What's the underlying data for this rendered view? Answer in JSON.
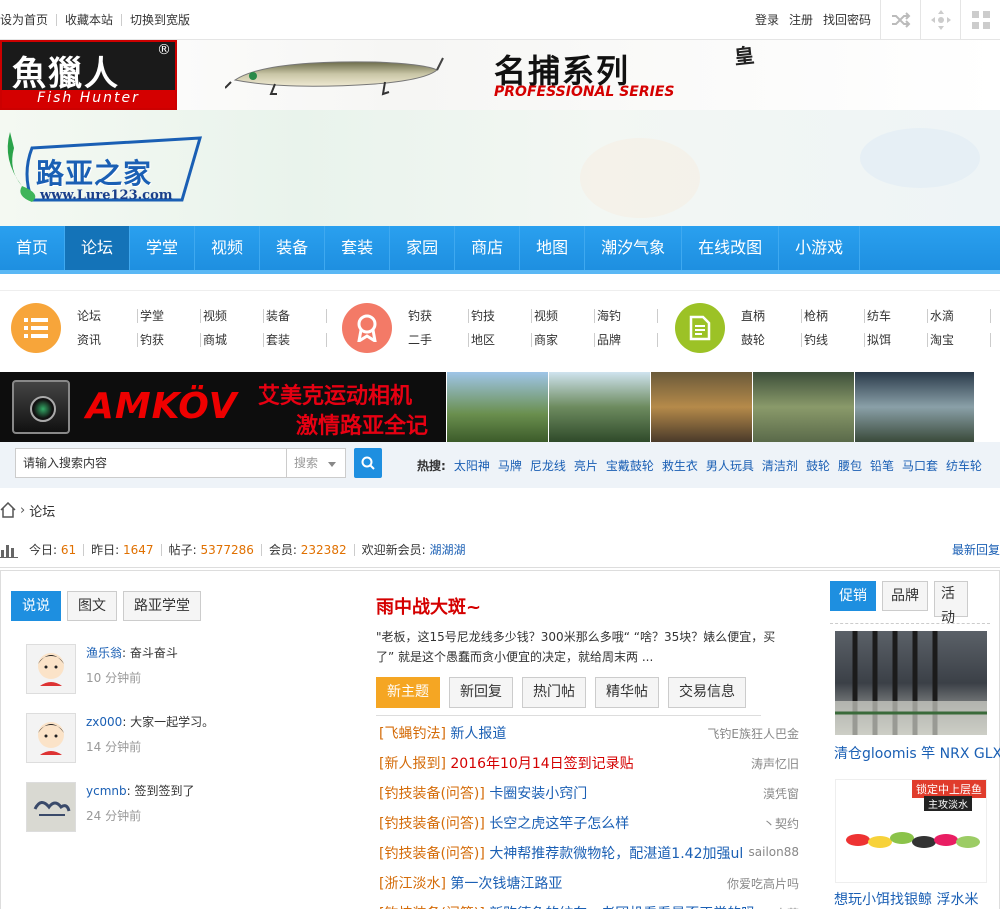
{
  "topbar": {
    "left_links": [
      "设为首页",
      "收藏本站",
      "切换到宽版"
    ],
    "right_links": [
      "登录",
      "注册",
      "找回密码"
    ],
    "icons": [
      "shuffle-icon",
      "move-icon",
      "grid-icon"
    ]
  },
  "banner": {
    "brand_cn": "魚獵人",
    "brand_en": "Fish Hunter",
    "brand_reg": "®",
    "slogan": "名捕系列",
    "slogan_en": "PROFESSIONAL SERIES",
    "slogan_extra": "皇"
  },
  "site": {
    "logo_text": "路亚之家",
    "logo_url": "www.Lure123.com"
  },
  "nav": {
    "items": [
      "首页",
      "论坛",
      "学堂",
      "视频",
      "装备",
      "套装",
      "家园",
      "商店",
      "地图",
      "潮汐气象",
      "在线改图",
      "小游戏"
    ],
    "active_index": 1
  },
  "categories": {
    "group1": {
      "icon": "list-icon",
      "color": "#f7a53a",
      "links": [
        "论坛",
        "学堂",
        "视频",
        "装备",
        "资讯",
        "钓获",
        "商城",
        "套装"
      ]
    },
    "group2": {
      "icon": "award-icon",
      "color": "#f37a67",
      "links": [
        "钓获",
        "钓技",
        "视频",
        "海钓",
        "二手",
        "地区",
        "商家",
        "品牌"
      ]
    },
    "group3": {
      "icon": "document-icon",
      "color": "#9cc226",
      "links": [
        "直柄",
        "枪柄",
        "纺车",
        "水滴",
        "鼓轮",
        "钓线",
        "拟饵",
        "淘宝"
      ]
    }
  },
  "ad": {
    "brand": "AMKÖV",
    "line1": "艾美克运动相机",
    "line2": "激情路亚全记录"
  },
  "search": {
    "placeholder": "请输入搜索内容",
    "select_value": "搜索",
    "hot_label": "热搜:",
    "hot_keywords": [
      "太阳神",
      "马牌",
      "尼龙线",
      "亮片",
      "宝戴鼓轮",
      "救生衣",
      "男人玩具",
      "清洁剂",
      "鼓轮",
      "腰包",
      "铅笔",
      "马口套",
      "纺车轮"
    ]
  },
  "breadcrumb": {
    "current": "论坛"
  },
  "stats": {
    "today_label": "今日:",
    "today": "61",
    "yesterday_label": "昨日:",
    "yesterday": "1647",
    "posts_label": "帖子:",
    "posts": "5377286",
    "members_label": "会员:",
    "members": "232382",
    "welcome_label": "欢迎新会员:",
    "newest": "湖湖湖",
    "latest_link": "最新回复"
  },
  "left_tabs": [
    "说说",
    "图文",
    "路亚学堂"
  ],
  "shouts": [
    {
      "user": "渔乐翁",
      "msg": "奋斗奋斗",
      "time": "10 分钟前"
    },
    {
      "user": "zx000",
      "msg": "大家一起学习。",
      "time": "14 分钟前"
    },
    {
      "user": "ycmnb",
      "msg": "签到签到了",
      "time": "24 分钟前"
    }
  ],
  "feature": {
    "title": "雨中战大斑~",
    "desc": "\"老板，这15号尼龙线多少钱？300米那么多哦“ “啥？35块？婊么便宜，买了” 就是这个愚蠢而贪小便宜的决定，就给周末两 ..."
  },
  "mid_tabs": [
    "新主题",
    "新回复",
    "热门帖",
    "精华帖",
    "交易信息"
  ],
  "threads": [
    {
      "tag": "[飞蝇钓法]",
      "title": "新人报道",
      "author": "飞钓E族狂人巴金",
      "red": false
    },
    {
      "tag": "[新人报到]",
      "title": "2016年10月14日签到记录贴",
      "author": "涛声忆旧",
      "red": true
    },
    {
      "tag": "[钓技装备(问答)]",
      "title": "卡圈安装小窍门",
      "author": "漠凭窗",
      "red": false
    },
    {
      "tag": "[钓技装备(问答)]",
      "title": "长空之虎这竿子怎么样",
      "author": "丶契约",
      "red": false
    },
    {
      "tag": "[钓技装备(问答)]",
      "title": "大神帮推荐款微物轮，配湛道1.42加强ul",
      "author": "sailon88",
      "red": false
    },
    {
      "tag": "[浙江淡水]",
      "title": "第一次钱塘江路亚",
      "author": "你爱吃高片吗",
      "red": false
    },
    {
      "tag": "[钓技装备(问答)]",
      "title": "新购德鱼的纺车，老团机看看是否正常的吗",
      "author": "泰菜",
      "red": false
    }
  ],
  "right_tabs": [
    "促销",
    "品牌",
    "活动"
  ],
  "promos": [
    {
      "caption": "清仓gloomis 竿  NRX GLX"
    },
    {
      "caption": "想玩小饵找银鲸  浮水米",
      "badge1": "锁定中上层鱼",
      "badge2": "主攻淡水"
    }
  ]
}
